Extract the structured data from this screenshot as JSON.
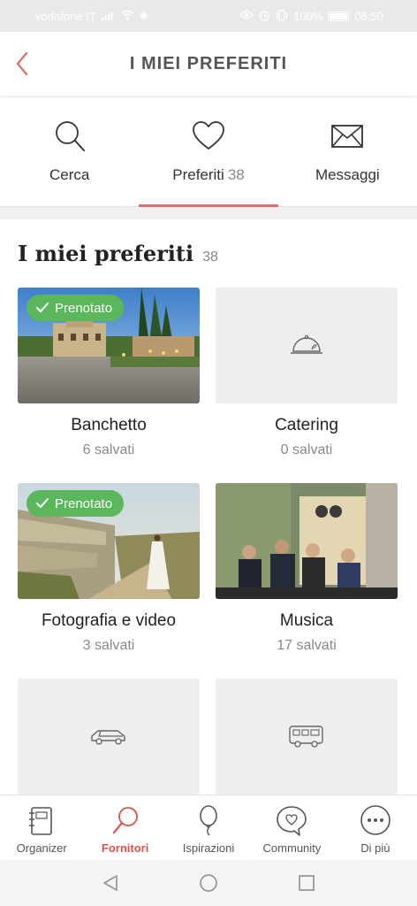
{
  "status_bar": {
    "carrier": "vodafone IT",
    "battery": "100%",
    "time": "08:50"
  },
  "header": {
    "title": "I MIEI PREFERITI"
  },
  "tabs": [
    {
      "label": "Cerca",
      "count": "",
      "icon": "search-icon"
    },
    {
      "label": "Preferiti",
      "count": "38",
      "icon": "heart-icon",
      "active": true
    },
    {
      "label": "Messaggi",
      "count": "",
      "icon": "envelope-icon"
    }
  ],
  "section": {
    "title": "I miei preferiti",
    "count": "38"
  },
  "cards": [
    {
      "name": "Banchetto",
      "saved": "6 salvati",
      "badge": "Prenotato",
      "image": "venue-photo"
    },
    {
      "name": "Catering",
      "saved": "0 salvati",
      "badge": "",
      "image": "cloche-icon"
    },
    {
      "name": "Fotografia e video",
      "saved": "3 salvati",
      "badge": "Prenotato",
      "image": "bride-photo"
    },
    {
      "name": "Musica",
      "saved": "17 salvati",
      "badge": "",
      "image": "band-photo"
    },
    {
      "name": "",
      "saved": "",
      "badge": "",
      "image": "car-icon"
    },
    {
      "name": "",
      "saved": "",
      "badge": "",
      "image": "van-icon"
    }
  ],
  "bottom_nav": [
    {
      "label": "Organizer",
      "icon": "notebook-icon"
    },
    {
      "label": "Fornitori",
      "icon": "magnifier-icon",
      "active": true
    },
    {
      "label": "Ispirazioni",
      "icon": "balloon-icon"
    },
    {
      "label": "Community",
      "icon": "chat-heart-icon"
    },
    {
      "label": "Di più",
      "icon": "more-icon"
    }
  ],
  "colors": {
    "accent": "#d9534f",
    "badge": "#5bb75b",
    "placeholder": "#eeeeee"
  }
}
